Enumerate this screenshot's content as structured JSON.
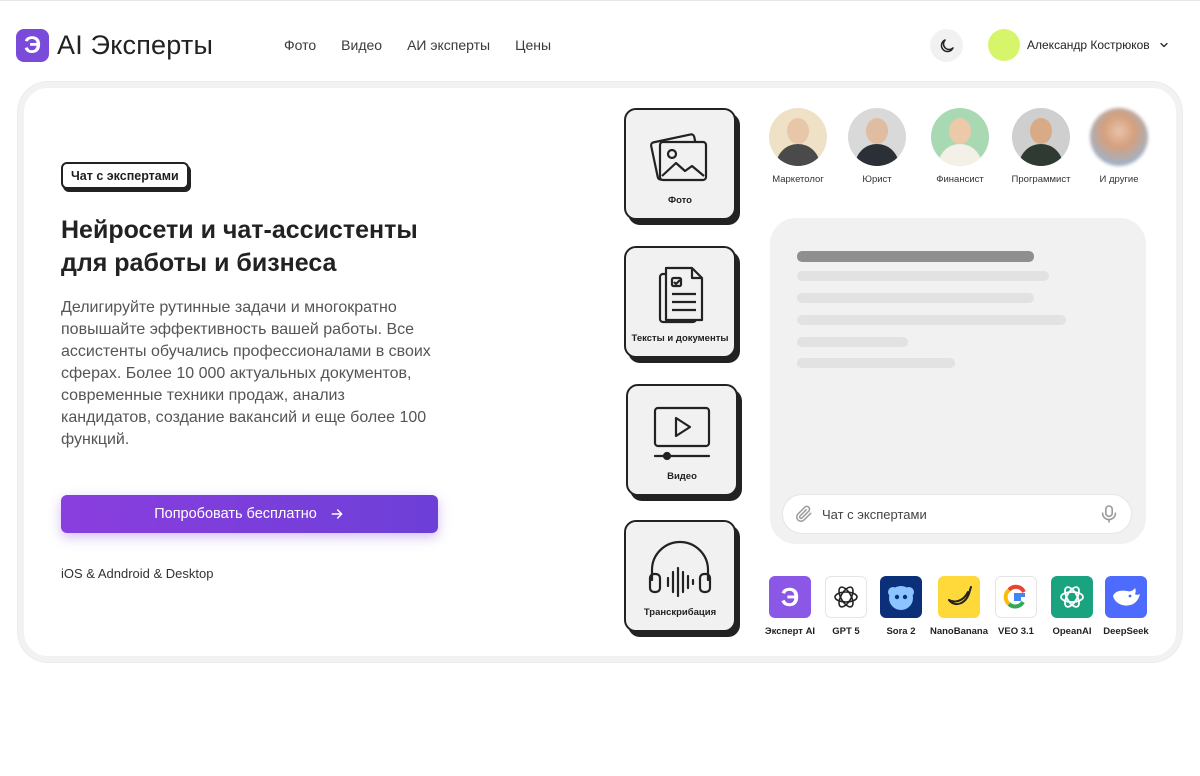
{
  "header": {
    "logo_mark": "Э",
    "logo_text": "AI Эксперты",
    "nav": [
      "Фото",
      "Видео",
      "АИ эксперты",
      "Цены"
    ],
    "user_name": "Александр Кострюков"
  },
  "hero": {
    "badge": "Чат с экспертами",
    "headline_line1": "Нейросети и чат-ассистенты",
    "headline_line2": "для работы и бизнеса",
    "description": "Делигируйте рутинные задачи и многократно повышайте эффективность вашей работы. Все ассистенты обучались профессионалами в своих сферах. Более 10 000 актуальных документов, современные техники продаж, анализ кандидатов, создание вакансий и еще более 100 функций.",
    "cta": "Попробовать бесплатно",
    "platforms": "iOS & Adndroid & Desktop"
  },
  "tiles": [
    {
      "label": "Фото",
      "icon": "photo-icon"
    },
    {
      "label": "Тексты и документы",
      "icon": "document-icon"
    },
    {
      "label": "Видео",
      "icon": "video-icon"
    },
    {
      "label": "Транскрибация",
      "icon": "headphones-icon"
    }
  ],
  "experts": [
    "Маркетолог",
    "Юрист",
    "Финансист",
    "Программист",
    "И другие"
  ],
  "chat": {
    "placeholder": "Чат с экспертами"
  },
  "models": [
    "Эксперт AI",
    "GPT 5",
    "Sora 2",
    "NanoBanana",
    "VEO 3.1",
    "OpeanAI",
    "DeepSeek"
  ],
  "colors": {
    "brand": "#7a4ad8",
    "cta_start": "#8a3ede",
    "cta_end": "#6d3fd8",
    "avatar": "#d6f56b"
  }
}
